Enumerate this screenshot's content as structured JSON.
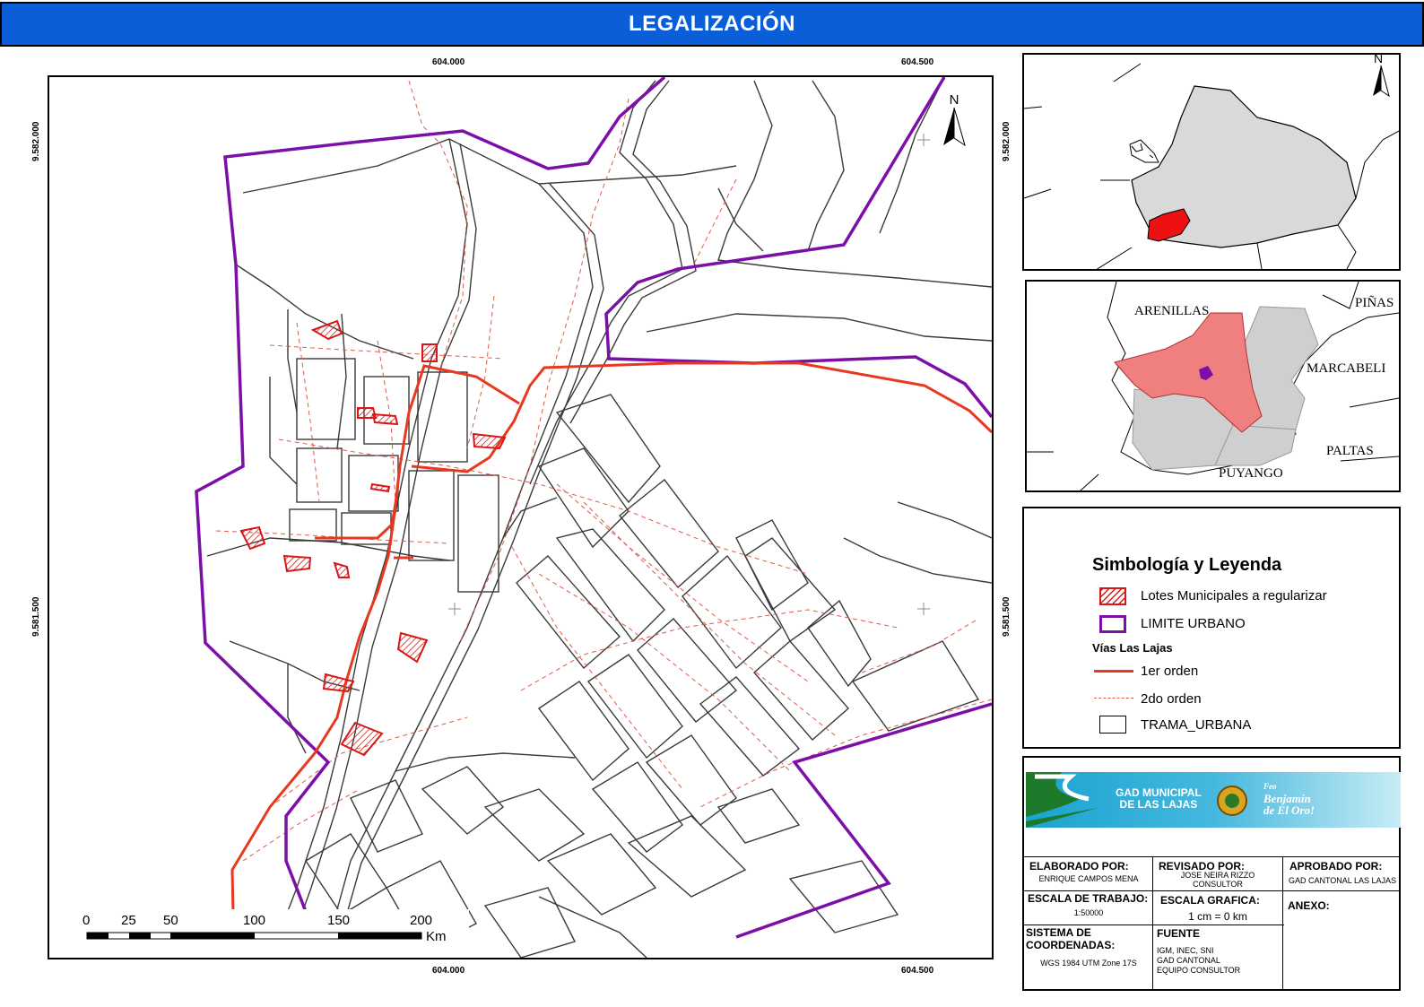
{
  "header": {
    "title": "LEGALIZACIÓN"
  },
  "map": {
    "coords_top": [
      "604.000",
      "604.500"
    ],
    "coords_bottom": [
      "604.000",
      "604.500"
    ],
    "coords_left": [
      "9.582.000",
      "9.581.500"
    ],
    "coords_right": [
      "9.582.000",
      "9.581.500"
    ],
    "north_label": "N",
    "scale_bar": {
      "ticks": [
        "0",
        "25",
        "50",
        "100",
        "150",
        "200"
      ],
      "unit": "Km"
    }
  },
  "inset_region": {
    "north_label": "N"
  },
  "inset_canton": {
    "labels": [
      "ARENILLAS",
      "PIÑAS",
      "MARCABELI",
      "PALTAS",
      "PUYANGO"
    ]
  },
  "legend": {
    "title": "Simbología y Leyenda",
    "items": [
      {
        "label": "Lotes Municipales a regularizar",
        "symbol": "hatched-red-square"
      },
      {
        "label": "LIMITE URBANO",
        "symbol": "purple-outline-square"
      }
    ],
    "roads_heading": "Vías Las Lajas",
    "roads": [
      {
        "label": "1er orden",
        "symbol": "solid-red-line"
      },
      {
        "label": "2do orden",
        "symbol": "dashed-red-line"
      }
    ],
    "other": [
      {
        "label": "TRAMA_URBANA",
        "symbol": "black-outline-square"
      }
    ]
  },
  "title_block": {
    "banner": {
      "org_line1": "GAD MUNICIPAL",
      "org_line2": "DE LAS LAJAS",
      "slogan_line1": "Benjamín",
      "slogan_line2": "de El Oro!",
      "slogan_prefix": "Feo"
    },
    "elaborado_label": "ELABORADO POR:",
    "elaborado_value": "ENRIQUE CAMPOS MENA",
    "revisado_label": "REVISADO POR:",
    "revisado_value1": "JOSE NEIRA RIZZO",
    "revisado_value2": "CONSULTOR",
    "aprobado_label": "APROBADO POR:",
    "aprobado_value": "GAD CANTONAL LAS LAJAS",
    "escala_trabajo_label": "ESCALA DE TRABAJO:",
    "escala_trabajo_value": "1:50000",
    "escala_grafica_label": "ESCALA GRAFICA:",
    "escala_grafica_value": "1 cm = 0 km",
    "anexo_label": "ANEXO:",
    "sistema_label1": "SISTEMA DE",
    "sistema_label2": "COORDENADAS:",
    "sistema_value": "WGS 1984 UTM Zone 17S",
    "fuente_label": "FUENTE",
    "fuente_value1": "IGM, INEC, SNI",
    "fuente_value2": "GAD CANTONAL",
    "fuente_value3": "EQUIPO CONSULTOR"
  },
  "colors": {
    "header_blue": "#0a5ed8",
    "urban_limit": "#7b0fa8",
    "road_red": "#e8381f",
    "lot_red": "#d81818",
    "canton_highlight": "#f08080",
    "neighbor_gray": "#d3d3d3"
  }
}
